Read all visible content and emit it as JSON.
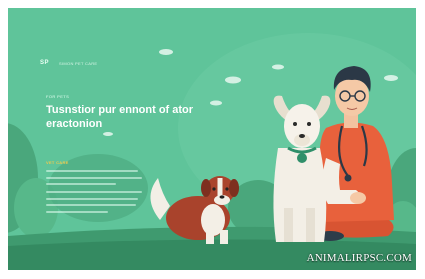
{
  "hero": {
    "logo_mark": "SP",
    "logo_text": "SIMON PET CARE",
    "eyebrow": "FOR PETS",
    "headline": "Tusnstior pur ennont of ator eractonion",
    "subhead": "VET CARE"
  },
  "watermark": {
    "text": "ANIMALIRPSC.COM"
  },
  "colors": {
    "background": "#5fc49a",
    "vet_scrubs": "#e8613c",
    "dog_brown": "#a9432c",
    "dog_white": "#f3efe6",
    "collar": "#2f8f6a"
  },
  "illustration": {
    "subjects": [
      "veterinarian-icon",
      "white-dog-icon",
      "brown-puppy-icon"
    ]
  }
}
